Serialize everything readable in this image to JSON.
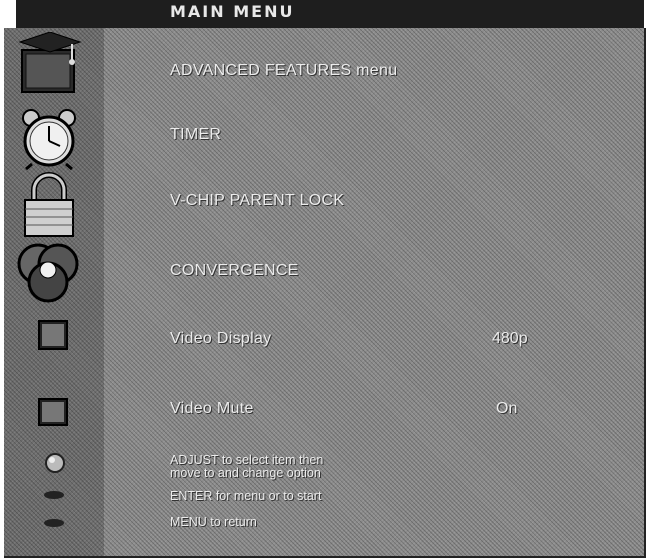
{
  "title": "MAIN MENU",
  "menu": {
    "items": [
      {
        "label": "ADVANCED FEATURES menu",
        "icon": "tv-graduation-cap-icon",
        "value": ""
      },
      {
        "label": "TIMER",
        "icon": "alarm-clock-icon",
        "value": ""
      },
      {
        "label": "V-CHIP PARENT LOCK",
        "icon": "padlock-icon",
        "value": ""
      },
      {
        "label": "CONVERGENCE",
        "icon": "convergence-circles-icon",
        "value": ""
      },
      {
        "label": "Video Display",
        "icon": "square-icon",
        "value": "480p"
      },
      {
        "label": "Video Mute",
        "icon": "square-icon",
        "value": "On"
      }
    ]
  },
  "help": {
    "adjust_line1": "ADJUST to select item then",
    "adjust_line2": "move to and change option",
    "enter": "ENTER for menu or to start",
    "menu_return": "MENU to return"
  },
  "colors": {
    "panel": "#8c8c8c",
    "sidebar": "#6e6e6e",
    "text": "#ececec",
    "title_bar": "#1e1e1e"
  }
}
